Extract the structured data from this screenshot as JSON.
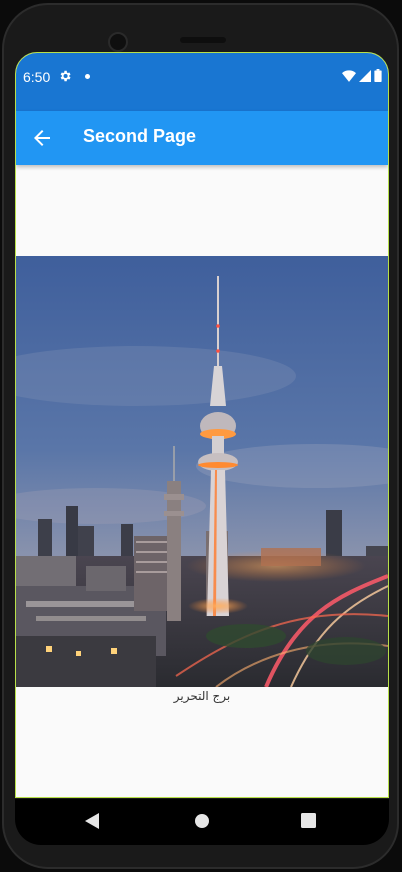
{
  "status_bar": {
    "time": "6:50",
    "icons": [
      "gear-icon",
      "notification-dot-icon",
      "wifi-icon",
      "signal-icon",
      "battery-icon"
    ]
  },
  "app_bar": {
    "title": "Second Page",
    "back_icon": "arrow-back-icon",
    "color": "#2196f3"
  },
  "content": {
    "image_subject": "tower-city-night-photo",
    "caption": "برج التحرير"
  },
  "nav_bar": {
    "icons": [
      "nav-back-icon",
      "nav-home-icon",
      "nav-recents-icon"
    ]
  },
  "colors": {
    "status_bar": "#1976d2",
    "app_bar": "#2196f3",
    "background": "#fafafa"
  }
}
